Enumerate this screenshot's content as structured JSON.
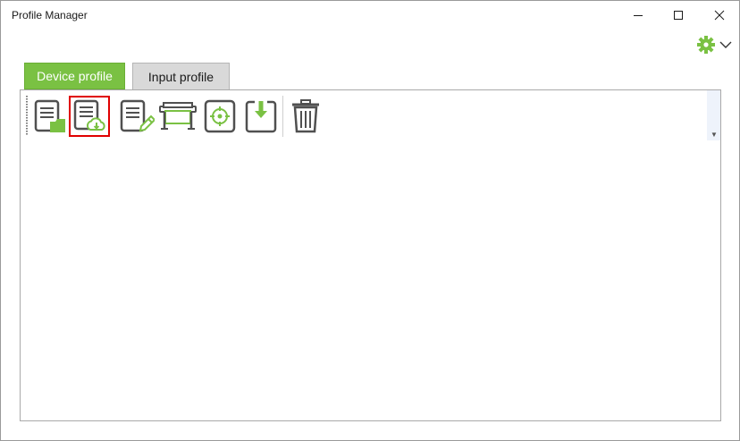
{
  "window": {
    "title": "Profile Manager"
  },
  "titlebar_buttons": [
    "minimize",
    "maximize",
    "close"
  ],
  "settings": {
    "icon": "gear-icon",
    "dropdown": "chevron-down-icon"
  },
  "tabs": [
    {
      "label": "Device profile",
      "active": true
    },
    {
      "label": "Input profile",
      "active": false
    }
  ],
  "toolbar": {
    "tools": [
      {
        "icon": "open-profile-folder-icon",
        "selected": false
      },
      {
        "icon": "download-profile-cloud-icon",
        "selected": true
      },
      {
        "icon": "edit-profile-icon",
        "selected": false
      },
      {
        "icon": "printer-icon",
        "selected": false
      },
      {
        "icon": "target-icon",
        "selected": false
      },
      {
        "icon": "import-download-icon",
        "selected": false
      },
      {
        "icon": "trash-icon",
        "selected": false
      }
    ]
  },
  "colors": {
    "accent": "#7ac143",
    "icon_gray": "#505050",
    "selection": "#e00000"
  }
}
